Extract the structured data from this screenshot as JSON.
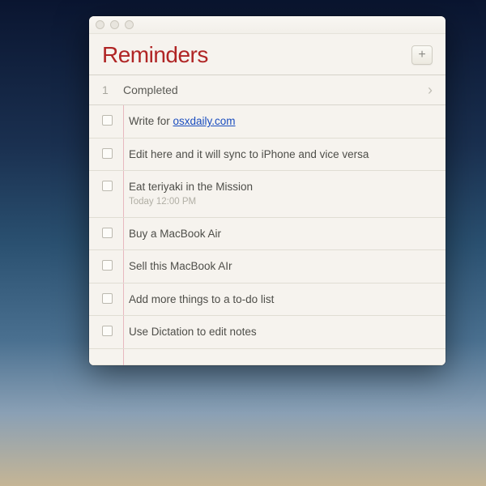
{
  "app": {
    "title": "Reminders"
  },
  "completed": {
    "count": "1",
    "label": "Completed"
  },
  "items": [
    {
      "prefix": "Write for ",
      "link_text": "osxdaily.com",
      "sub": null
    },
    {
      "text": "Edit here and it will sync to iPhone and vice versa",
      "sub": null
    },
    {
      "text": "Eat teriyaki in the Mission",
      "sub": "Today 12:00 PM"
    },
    {
      "text": "Buy a MacBook Air",
      "sub": null
    },
    {
      "text": "Sell this MacBook AIr",
      "sub": null
    },
    {
      "text": "Add more things to a to-do list",
      "sub": null
    },
    {
      "text": "Use Dictation to edit notes",
      "sub": null
    }
  ]
}
